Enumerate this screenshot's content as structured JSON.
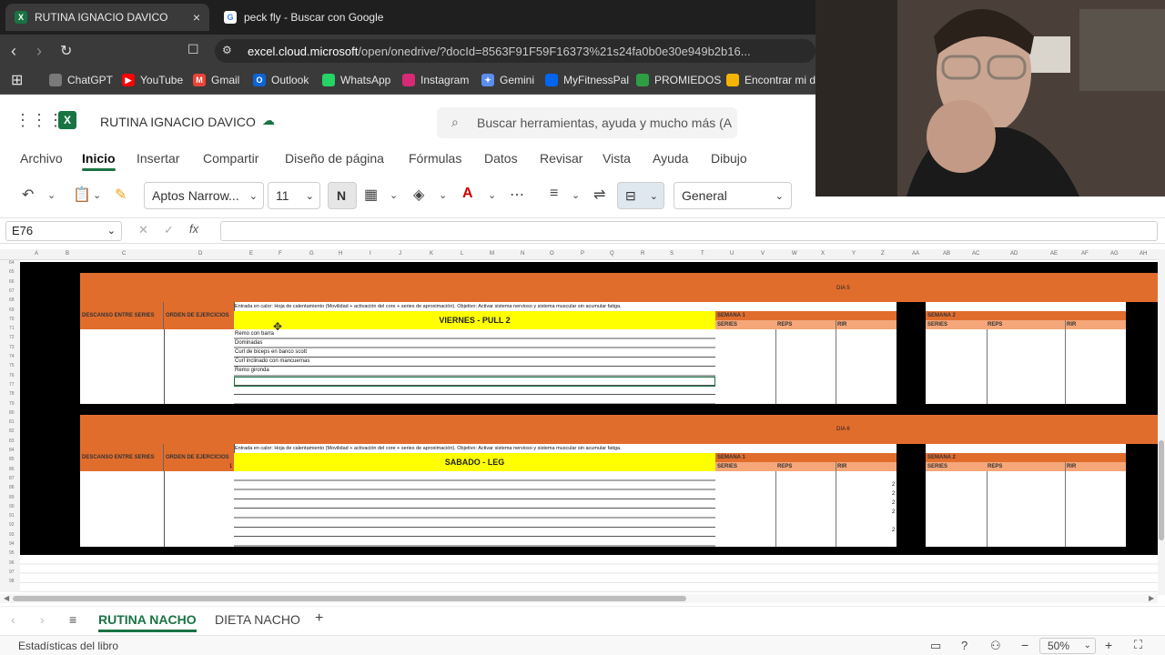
{
  "browser": {
    "tabs": [
      {
        "title": "RUTINA IGNACIO DAVICO",
        "active": true,
        "close": "×"
      },
      {
        "title": "peck fly - Buscar con Google",
        "active": false
      }
    ],
    "new_tab": "+",
    "url_host": "excel.cloud.microsoft",
    "url_path": "/open/onedrive/?docId=8563F91F59F16373%21s24fa0b0e30e949b2b16...",
    "bookmarks": [
      {
        "label": "ChatGPT",
        "color": "#7a7a7a"
      },
      {
        "label": "YouTube",
        "color": "#ff0000"
      },
      {
        "label": "Gmail",
        "color": "#ea4335"
      },
      {
        "label": "Outlook",
        "color": "#0a64d6"
      },
      {
        "label": "WhatsApp",
        "color": "#25d366"
      },
      {
        "label": "Instagram",
        "color": "#d62976"
      },
      {
        "label": "Gemini",
        "color": "#5b8def"
      },
      {
        "label": "MyFitnessPal",
        "color": "#0066ee"
      },
      {
        "label": "PROMIEDOS",
        "color": "#2e9e44"
      },
      {
        "label": "Encontrar mi dis",
        "color": "#f4b400"
      }
    ]
  },
  "app": {
    "title": "RUTINA IGNACIO DAVICO",
    "search_placeholder": "Buscar herramientas, ayuda y mucho más (A",
    "menu": [
      "Archivo",
      "Inicio",
      "Insertar",
      "Compartir",
      "Diseño de página",
      "Fórmulas",
      "Datos",
      "Revisar",
      "Vista",
      "Ayuda",
      "Dibujo"
    ],
    "active_menu": "Inicio",
    "font_name": "Aptos Narrow...",
    "font_size": "11",
    "bold_label": "N",
    "number_format": "General",
    "name_box": "E76",
    "fx_label": "fx"
  },
  "columns": [
    "A",
    "B",
    "C",
    "D",
    "E",
    "F",
    "G",
    "H",
    "I",
    "J",
    "K",
    "L",
    "M",
    "N",
    "O",
    "P",
    "Q",
    "R",
    "S",
    "T",
    "U",
    "V",
    "W",
    "X",
    "Y",
    "Z",
    "AA",
    "AB",
    "AC",
    "AD",
    "AE",
    "AF",
    "AG",
    "AH"
  ],
  "rows": [
    "64",
    "65",
    "66",
    "67",
    "68",
    "69",
    "70",
    "71",
    "72",
    "73",
    "74",
    "75",
    "76",
    "77",
    "78",
    "79",
    "80",
    "81",
    "82",
    "83",
    "84",
    "85",
    "86",
    "87",
    "88",
    "89",
    "90",
    "91",
    "92",
    "93",
    "94",
    "95",
    "96",
    "97",
    "98"
  ],
  "sheet": {
    "day5": {
      "day_label": "DIA 5",
      "rest_header": "DESCANSO ENTRE SERIES",
      "order_header": "ORDEN DE EJERCICIOS",
      "warmup": "Entrada en calor: Hoja de calentamiento (Movilidad + activación del core + series de aproximación). Objetivo: Activar sistema nervioso y sistema muscular sin acumular fatiga.",
      "title": "VIERNES - PULL 2",
      "exercises": [
        "Remo con barra",
        "Dominadas",
        "Curl de biceps en banco scott",
        "Curl inclinado con mancuernas",
        "Remo gironda"
      ],
      "week1": "SEMANA 1",
      "week2": "SEMANA 2",
      "cols": [
        "SERIES",
        "REPS",
        "RIR"
      ]
    },
    "day6": {
      "day_label": "DIA 6",
      "rest_header": "DESCANSO ENTRE SERIES",
      "order_header": "ORDEN DE EJERCICIOS",
      "warmup": "Entrada en calor: Hoja de calentamiento (Movilidad + activación del core + series de aproximación). Objetivo: Activar sistema nervioso y sistema muscular sin acumular fatiga.",
      "title": "SABADO - LEG",
      "order_value": "1",
      "rir_values": [
        "2",
        "2",
        "2",
        "2",
        "2"
      ],
      "week1": "SEMANA 1",
      "week2": "SEMANA 2",
      "cols": [
        "SERIES",
        "REPS",
        "RIR"
      ]
    }
  },
  "sheet_tabs": [
    {
      "label": "RUTINA NACHO",
      "active": true
    },
    {
      "label": "DIETA NACHO",
      "active": false
    }
  ],
  "add_sheet": "+",
  "status": {
    "left": "Estadísticas del libro",
    "zoom": "50%"
  },
  "colors": {
    "orange": "#e16d2d",
    "yellow": "#ffff00",
    "excel_green": "#1a7343"
  }
}
